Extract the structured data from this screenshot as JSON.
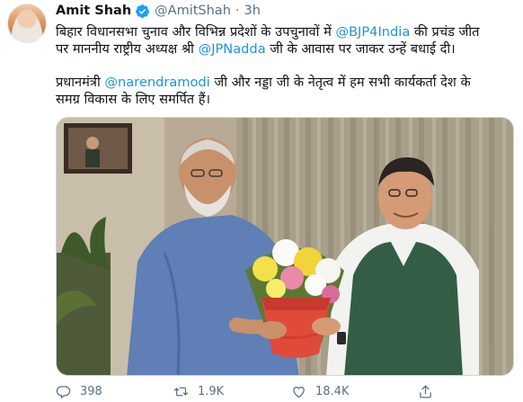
{
  "tweet": {
    "author_name": "Amit Shah",
    "handle": "@AmitShah",
    "separator": "·",
    "time": "3h",
    "line1": "बिहार विधानसभा चुनाव और विभिन्न प्रदेशों के उपचुनावों में ",
    "mention_bjp": "@BJP4India",
    "line1_end": " की प्रचंड जीत",
    "line2_start": "पर माननीय राष्ट्रीय अध्यक्ष श्री ",
    "mention_nadda": "@JPNadda",
    "line2_end": " जी के आवास पर जाकर उन्हें बधाई दी।",
    "line3_start": "प्रधानमंत्री ",
    "mention_modi": "@narendramodi",
    "line3_end": " जी और नड्डा जी के नेतृत्व में हम सभी कार्यकर्ता देश के",
    "line4": "समग्र विकास के लिए समर्पित हैं।"
  },
  "metrics": {
    "replies": "398",
    "retweets": "1.9K",
    "likes": "18.4K"
  },
  "colors": {
    "accent": "#1b95e0",
    "verified": "#1da1f2",
    "muted": "#5b7083"
  },
  "icons": [
    "verified-badge-icon",
    "reply-icon",
    "retweet-icon",
    "like-icon",
    "share-icon"
  ]
}
